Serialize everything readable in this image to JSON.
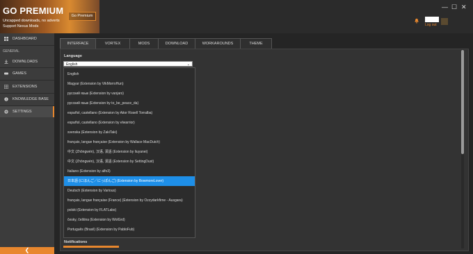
{
  "banner": {
    "title": "GO PREMIUM",
    "line1": "Uncapped downloads, no adverts",
    "line2": "Support Nexus Mods",
    "button": "Go Premium"
  },
  "window": {
    "minimize": "—",
    "maximize": "☐",
    "close": "✕"
  },
  "user": {
    "logout": "Log out"
  },
  "sidebar": {
    "dashboard": "DASHBOARD",
    "general": "GENERAL",
    "items": [
      "DOWNLOADS",
      "GAMES",
      "EXTENSIONS",
      "KNOWLEDGE BASE",
      "SETTINGS"
    ],
    "collapse": "❮"
  },
  "tabs": [
    "INTERFACE",
    "VORTEX",
    "MODS",
    "DOWNLOAD",
    "WORKAROUNDS",
    "THEME"
  ],
  "language": {
    "label": "Language",
    "selected": "English",
    "options": [
      "English",
      "Magyar (Extension by VikMorroHun)",
      "русский язык (Extension by vanjars)",
      "русский язык (Extension by to_be_peace_da)",
      "español, castellano (Extension by Aitor Rosell Torralba)",
      "español, castellano (Extension by elwarrior)",
      "svenska (Extension by ZakiTaki)",
      "français, langue française (Extension by Wallace MacDuich)",
      "中文 (Zhōngwén), 汉语, 漢語 (Extension by liuyanei)",
      "中文 (Zhōngwén), 汉语, 漢語 (Extension by SettingDust)",
      "Italiano (Extension by alfo3)",
      "日本語 (にほんご／にっぽんご) (Extension by BowmoreLover)",
      "Deutsch (Extension by Various)",
      "français, langue française (France) (Extension by Ozzydarkfirne - Ausgara)",
      "polski (Extension by FLATLabs)",
      "česky, čeština (Extension by WolGrd)",
      "Português (Brasil) (Extension by PabloFub)"
    ],
    "highlighted_index": 11
  },
  "notifications": {
    "label": "Notifications"
  },
  "colors": {
    "accent": "#e8872e",
    "highlight": "#1e8fe8"
  }
}
